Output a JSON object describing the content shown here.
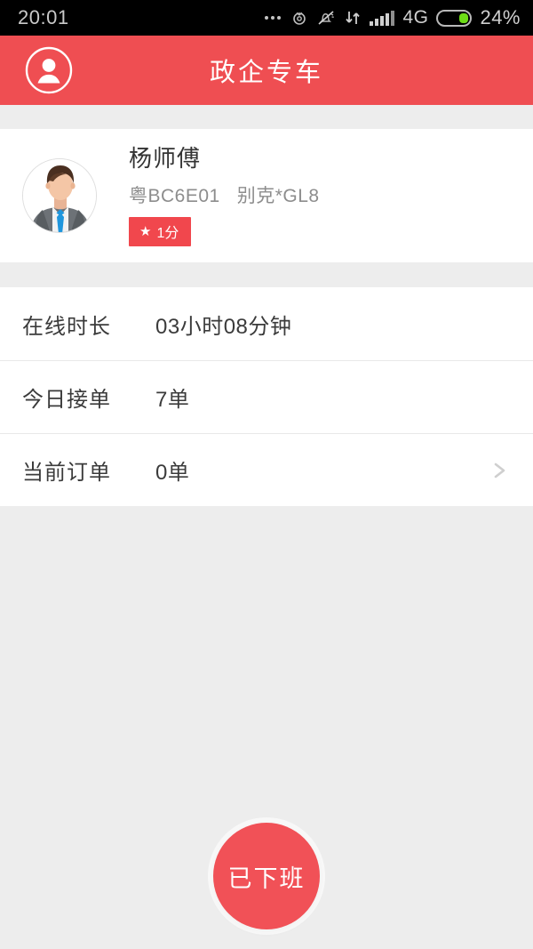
{
  "statusbar": {
    "time": "20:01",
    "network": "4G",
    "battery_percent": "24%",
    "icons": [
      "more-dots-icon",
      "alarm-icon",
      "mute-bell-icon",
      "data-transfer-icon",
      "signal-bars-icon",
      "battery-icon"
    ]
  },
  "header": {
    "title": "政企专车",
    "avatar_icon": "user-circle-icon"
  },
  "driver": {
    "avatar_icon": "driver-photo-avatar",
    "name": "杨师傅",
    "vehicle_line": "粤BC6E01   别克*GL8",
    "plate": "粤BC6E01",
    "car_model": "别克*GL8",
    "rating_star_icon": "star-icon",
    "rating": "1分"
  },
  "stats": {
    "rows": [
      {
        "label": "在线时长",
        "value": "03小时08分钟",
        "has_chevron": false
      },
      {
        "label": "今日接单",
        "value": "7单",
        "has_chevron": false
      },
      {
        "label": "当前订单",
        "value": "0单",
        "has_chevron": true
      }
    ]
  },
  "duty": {
    "button_label": "已下班"
  },
  "colors": {
    "brand_red": "#ef4e52",
    "button_red": "#f15157",
    "badge_red": "#f1474d",
    "page_bg": "#ededed",
    "card_bg": "#ffffff",
    "text_primary": "#3b3b3b",
    "text_secondary": "#8d8d8d",
    "battery_green": "#6ddc16"
  }
}
